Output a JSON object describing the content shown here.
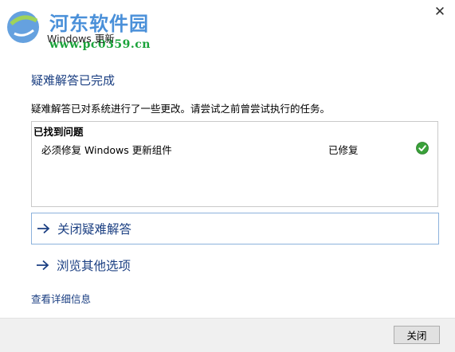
{
  "window": {
    "app_name": "Windows 更新",
    "close_glyph": "✕"
  },
  "watermark": {
    "title": "河东软件园",
    "url": "www.pc0359.cn"
  },
  "main": {
    "heading": "疑难解答已完成",
    "description": "疑难解答已对系统进行了一些更改。请尝试之前曾尝试执行的任务。",
    "issues": {
      "header": "已找到问题",
      "items": [
        {
          "name": "必须修复 Windows 更新组件",
          "status": "已修复",
          "status_icon": "green-check-icon"
        }
      ]
    },
    "options": [
      {
        "label": "关闭疑难解答",
        "icon": "arrow-right-icon"
      },
      {
        "label": "浏览其他选项",
        "icon": "arrow-right-icon"
      }
    ],
    "details_link": "查看详细信息"
  },
  "footer": {
    "close_button": "关闭"
  },
  "colors": {
    "accent": "#1b3f82",
    "check_green": "#3aa13a",
    "footer_bg": "#f0f0f0"
  }
}
